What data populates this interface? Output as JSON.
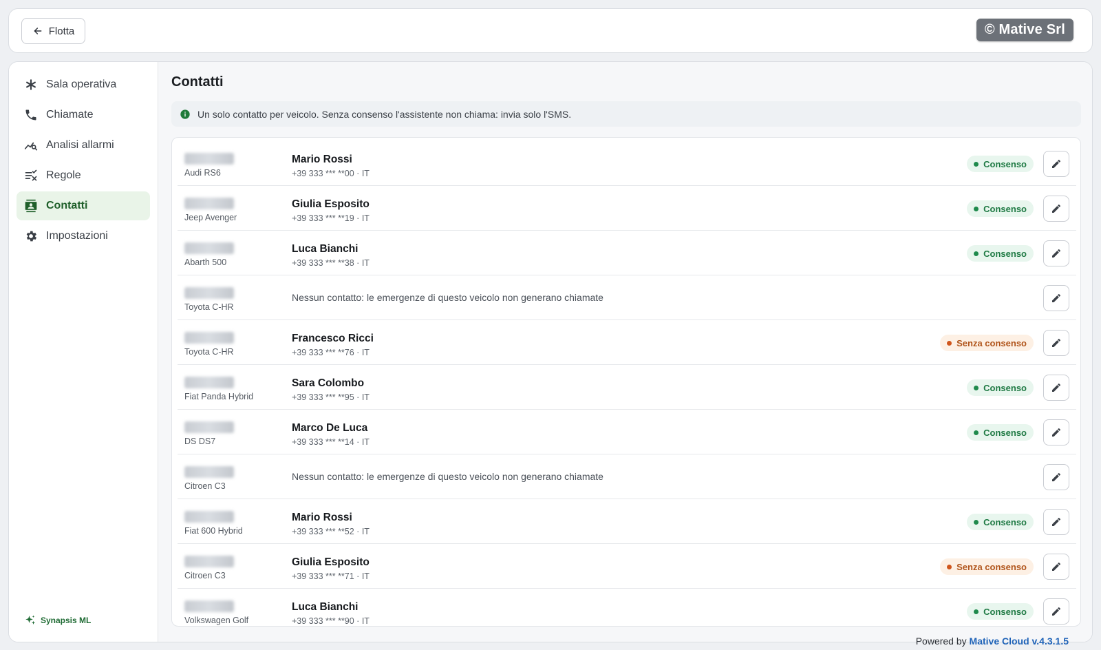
{
  "topbar": {
    "back_label": "Flotta",
    "brand": "© Mative Srl"
  },
  "sidebar": {
    "items": [
      {
        "label": "Sala operativa",
        "icon": "asterisk-icon"
      },
      {
        "label": "Chiamate",
        "icon": "phone-icon"
      },
      {
        "label": "Analisi allarmi",
        "icon": "chart-search-icon"
      },
      {
        "label": "Regole",
        "icon": "rules-icon"
      },
      {
        "label": "Contatti",
        "icon": "contacts-icon",
        "active": true
      },
      {
        "label": "Impostazioni",
        "icon": "gear-icon"
      }
    ],
    "footer_label": "Synapsis ML"
  },
  "main": {
    "title": "Contatti",
    "info": "Un solo contatto per veicolo. Senza consenso l'assistente non chiama: invia solo l'SMS.",
    "rows": [
      {
        "model": "Audi RS6",
        "name": "Mario Rossi",
        "phone": "+39 333 *** **00 · IT",
        "status": "Consenso",
        "consent": true
      },
      {
        "model": "Jeep Avenger",
        "name": "Giulia Esposito",
        "phone": "+39 333 *** **19 · IT",
        "status": "Consenso",
        "consent": true
      },
      {
        "model": "Abarth 500",
        "name": "Luca Bianchi",
        "phone": "+39 333 *** **38 · IT",
        "status": "Consenso",
        "consent": true
      },
      {
        "model": "Toyota C-HR",
        "empty": "Nessun contatto: le emergenze di questo veicolo non generano chiamate"
      },
      {
        "model": "Toyota C-HR",
        "name": "Francesco Ricci",
        "phone": "+39 333 *** **76 · IT",
        "status": "Senza consenso",
        "consent": false
      },
      {
        "model": "Fiat Panda Hybrid",
        "name": "Sara Colombo",
        "phone": "+39 333 *** **95 · IT",
        "status": "Consenso",
        "consent": true
      },
      {
        "model": "DS DS7",
        "name": "Marco De Luca",
        "phone": "+39 333 *** **14 · IT",
        "status": "Consenso",
        "consent": true
      },
      {
        "model": "Citroen C3",
        "empty": "Nessun contatto: le emergenze di questo veicolo non generano chiamate"
      },
      {
        "model": "Fiat 600 Hybrid",
        "name": "Mario Rossi",
        "phone": "+39 333 *** **52 · IT",
        "status": "Consenso",
        "consent": true
      },
      {
        "model": "Citroen C3",
        "name": "Giulia Esposito",
        "phone": "+39 333 *** **71 · IT",
        "status": "Senza consenso",
        "consent": false
      },
      {
        "model": "Volkswagen Golf",
        "name": "Luca Bianchi",
        "phone": "+39 333 *** **90 · IT",
        "status": "Consenso",
        "consent": true
      }
    ]
  },
  "footer": {
    "prefix": "Powered by",
    "product": "Mative Cloud v.4.3.1.5"
  },
  "colors": {
    "accent_green": "#1f5f2a",
    "consent_green": "#1f7a44",
    "no_consent_orange": "#b0541a",
    "link_blue": "#1f63b8"
  }
}
